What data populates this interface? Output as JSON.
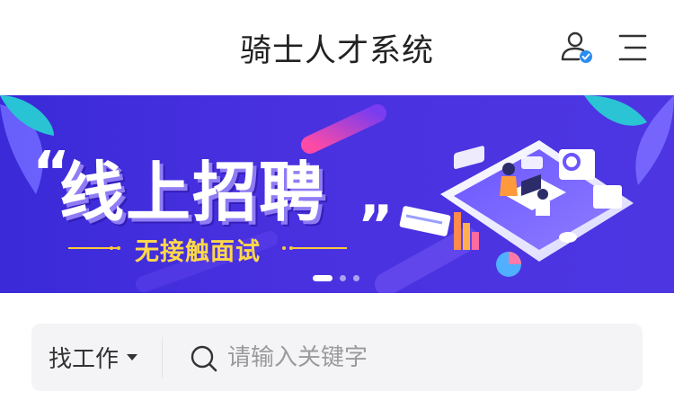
{
  "header": {
    "title": "骑士人才系统",
    "user_icon": "user-verified-icon",
    "menu_icon": "hamburger-menu-icon"
  },
  "banner": {
    "headline": "线上招聘",
    "quote_open": "“",
    "quote_close": "”",
    "subheadline": "无接触面试",
    "slides_total": 3,
    "active_slide": 1,
    "colors": {
      "background": "#4a31e0",
      "accent": "#ffd84a"
    }
  },
  "search": {
    "category_label": "找工作",
    "placeholder": "请输入关键字",
    "value": "",
    "icon": "search-icon"
  },
  "colors": {
    "title_text": "#222222",
    "search_background": "#f4f4f6",
    "verified_badge": "#2d8cf0"
  }
}
